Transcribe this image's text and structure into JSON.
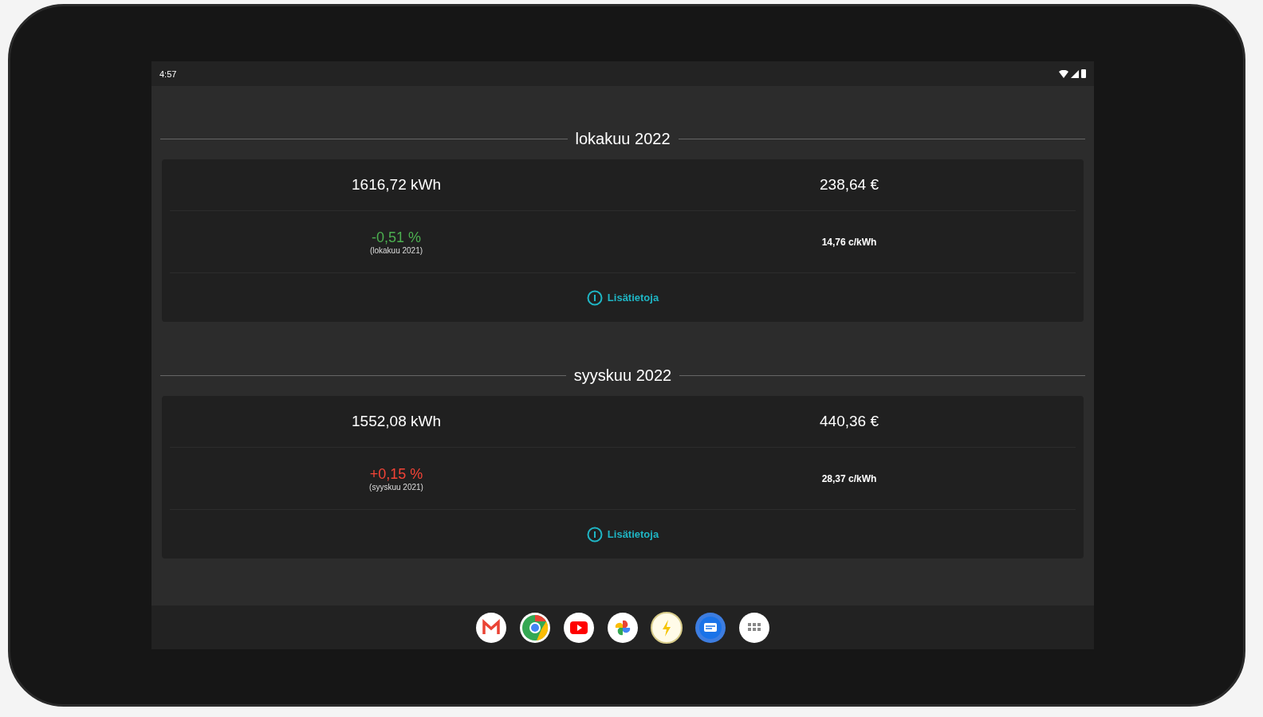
{
  "status_bar": {
    "time": "4:57"
  },
  "months": [
    {
      "title": "lokakuu 2022",
      "energy": "1616,72 kWh",
      "cost": "238,64 €",
      "change": "-0,51 %",
      "color": "#4caf50",
      "comparison": "(lokakuu 2021)",
      "unit_price": "14,76 c/kWh",
      "info_link": "Lisätietoja"
    },
    {
      "title": "syyskuu 2022",
      "energy": "1552,08 kWh",
      "cost": "440,36 €",
      "change": "+0,15 %",
      "color": "#f44336",
      "comparison": "(syyskuu 2021)",
      "unit_price": "28,37 c/kWh",
      "info_link": "Lisätietoja"
    }
  ],
  "dock": [
    {
      "kind": "mail"
    },
    {
      "kind": "browser"
    },
    {
      "kind": "video"
    },
    {
      "kind": "photos"
    },
    {
      "kind": "bolt"
    },
    {
      "kind": "message"
    },
    {
      "kind": "apps"
    }
  ]
}
